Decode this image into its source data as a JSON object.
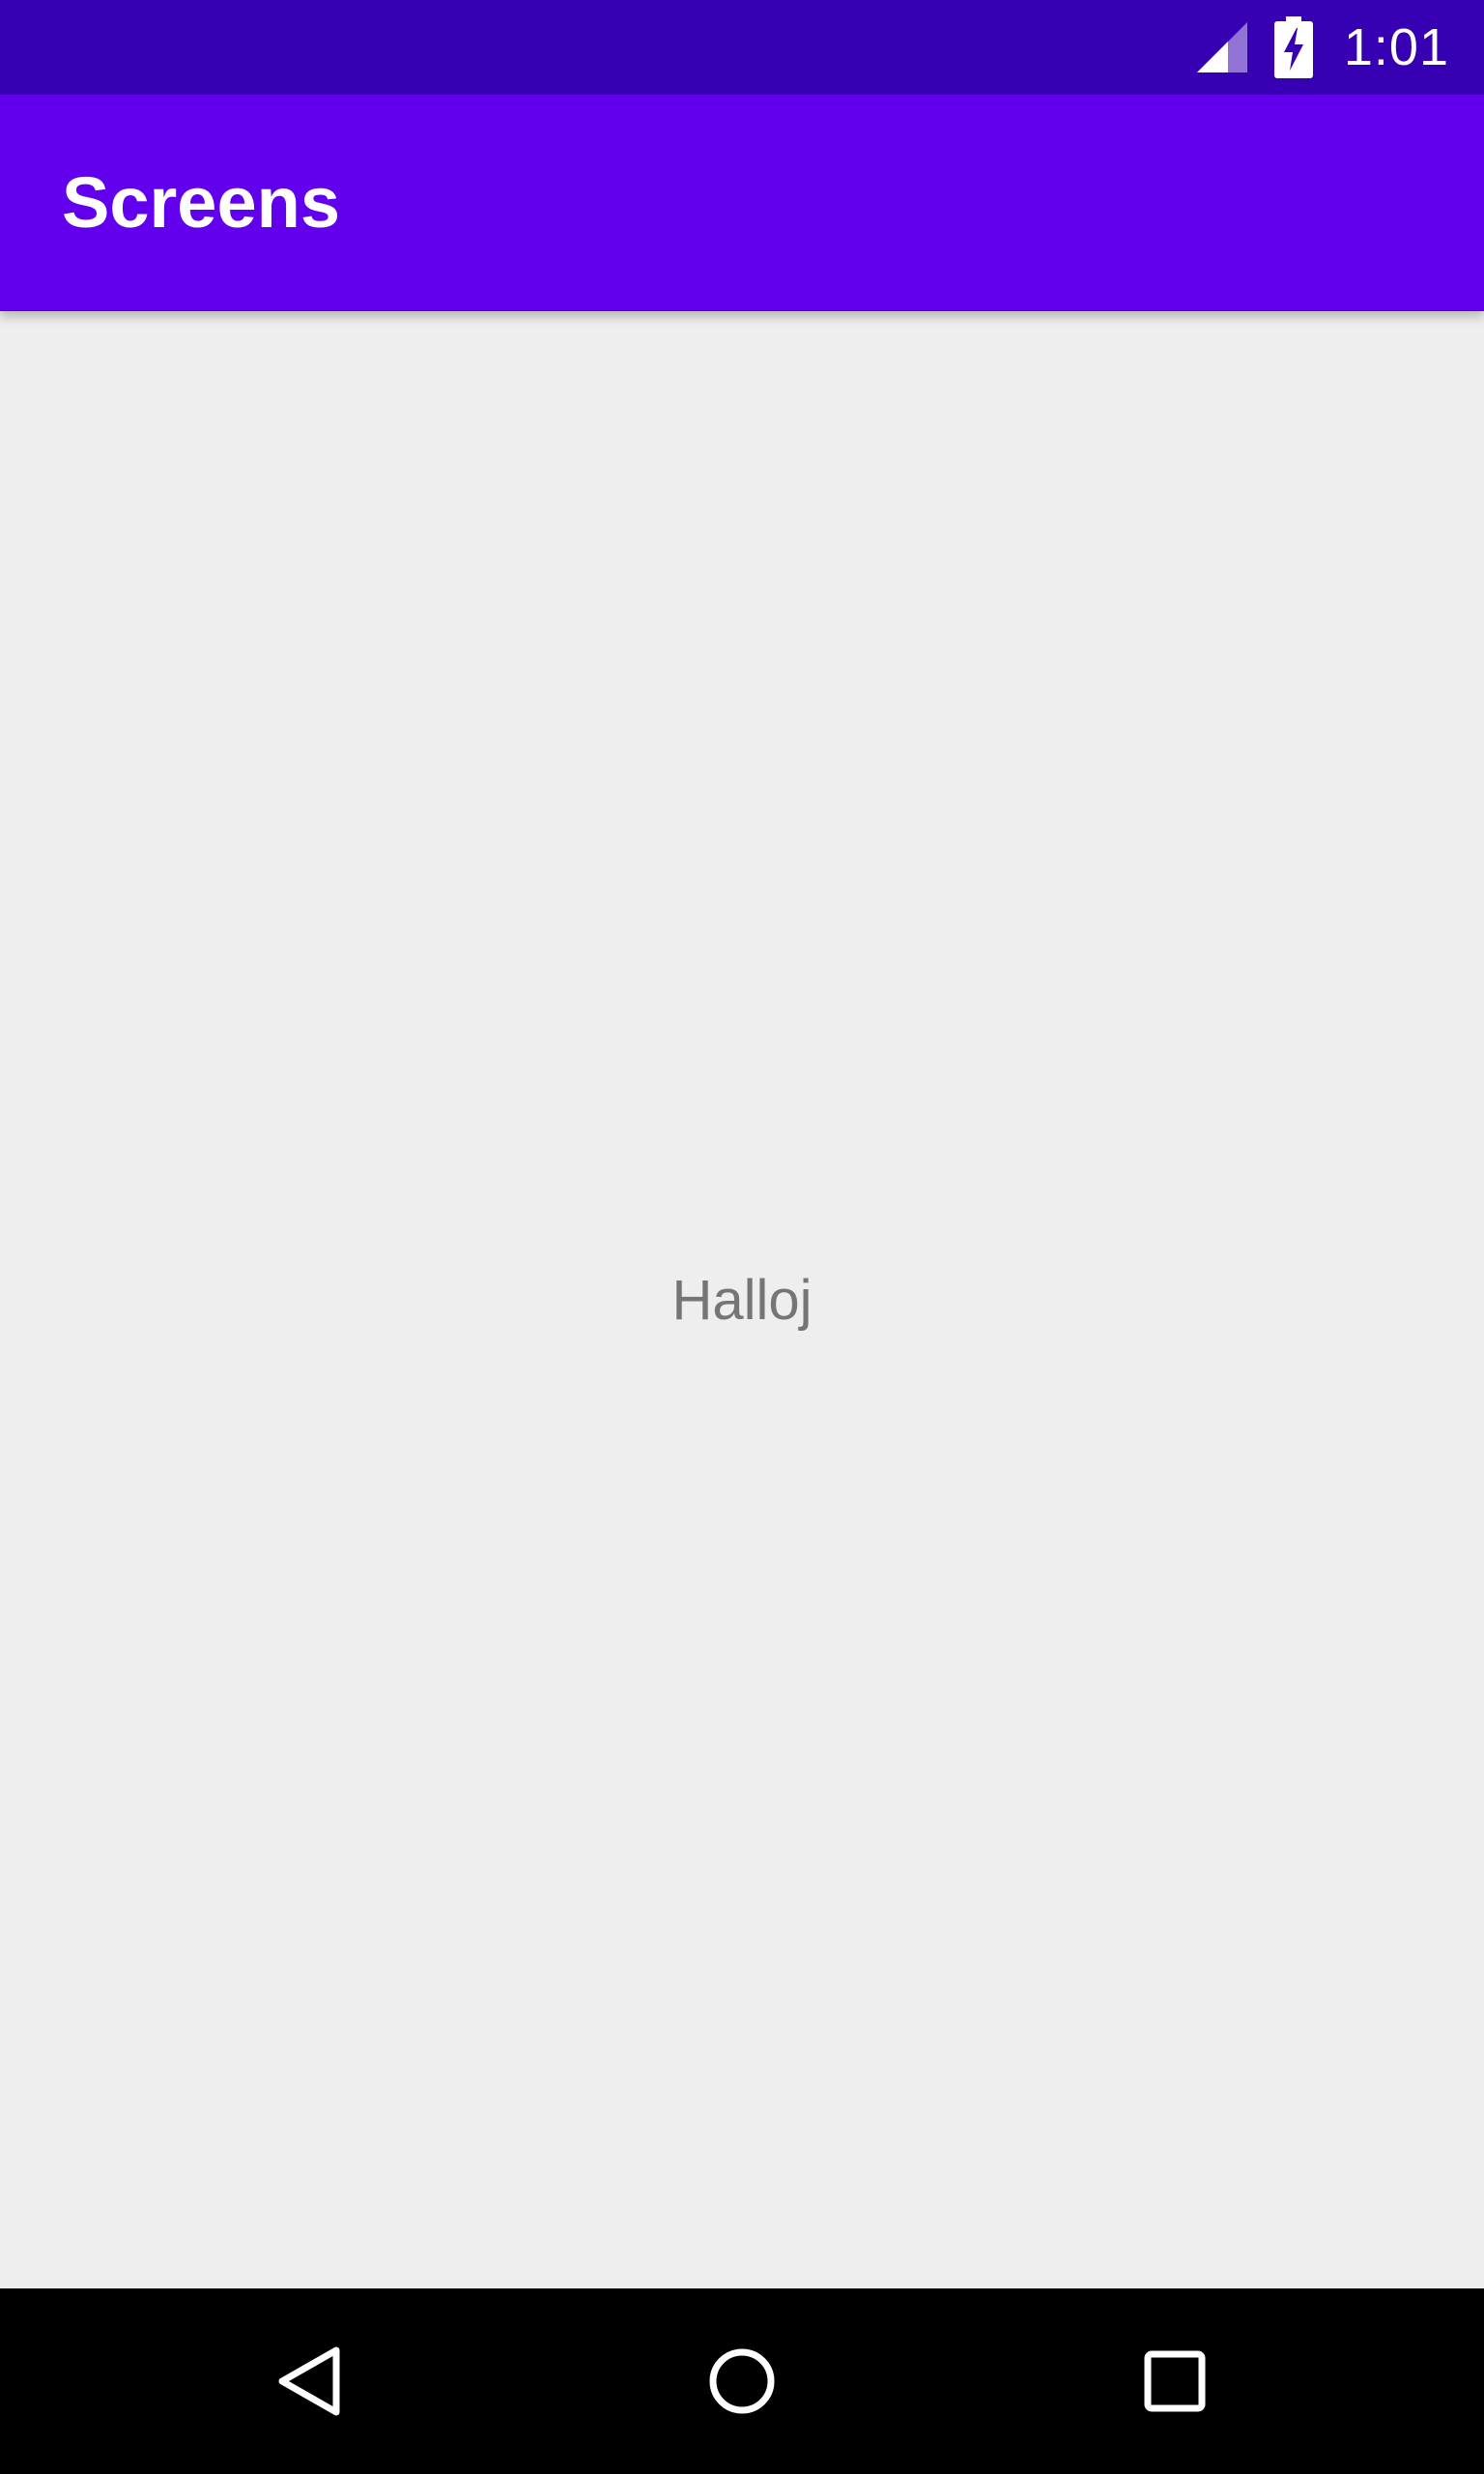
{
  "status_bar": {
    "time": "1:01",
    "icons": [
      "cell-signal-icon",
      "battery-charging-icon"
    ],
    "background": "#3700b3"
  },
  "app_bar": {
    "title": "Screens",
    "background": "#6200ee"
  },
  "content": {
    "text": "Halloj",
    "background": "#eeeeee"
  },
  "nav_bar": {
    "buttons": [
      "back-icon",
      "home-icon",
      "recents-icon"
    ],
    "background": "#000000"
  }
}
